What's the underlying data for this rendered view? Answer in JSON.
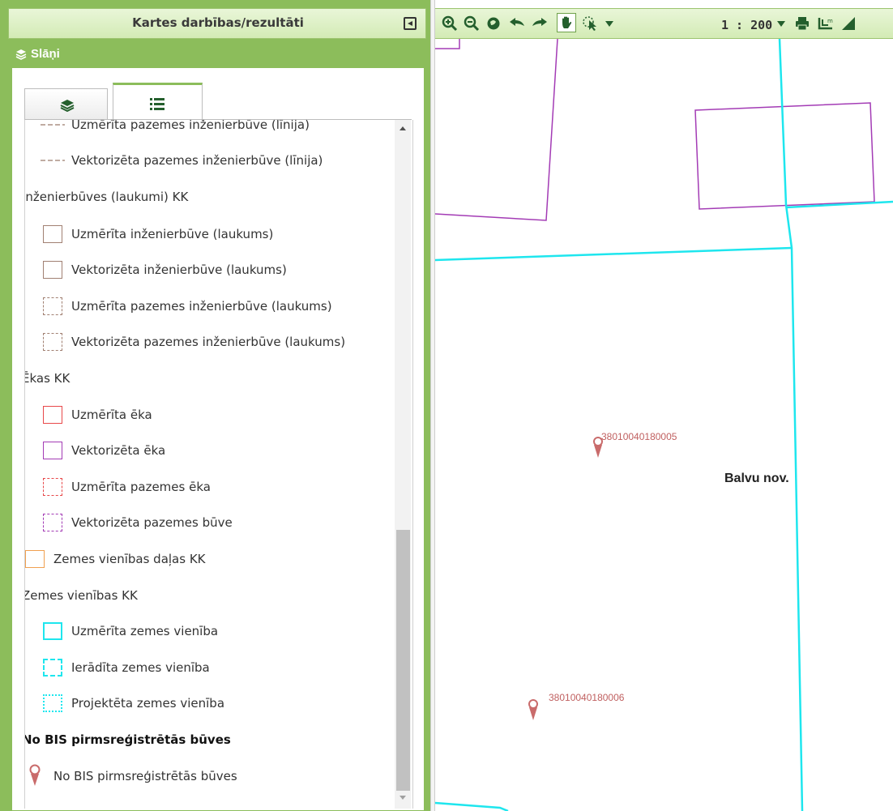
{
  "panel": {
    "title": "Kartes darbības/rezultāti",
    "layers_title": "Slāņi"
  },
  "legend": {
    "row1": "Uzmērīta pazemes inženierbūve (līnija)",
    "row2": "Vektorizēta pazemes inženierbūve (līnija)",
    "group1": "Inženierbūves (laukumi) KK",
    "row3": "Uzmērīta inženierbūve (laukums)",
    "row4": "Vektorizēta inženierbūve (laukums)",
    "row5": "Uzmērīta pazemes inženierbūve (laukums)",
    "row6": "Vektorizēta pazemes inženierbūve (laukums)",
    "group2": "Ēkas KK",
    "row7": "Uzmērīta ēka",
    "row8": "Vektorizēta ēka",
    "row9": "Uzmērīta pazemes ēka",
    "row10": "Vektorizēta pazemes būve",
    "row11": "Zemes vienības daļas KK",
    "group3": "Zemes vienības KK",
    "row12": "Uzmērīta zemes vienība",
    "row13": "Ierādīta zemes vienība",
    "row14": "Projektēta zemes vienība",
    "group4": "No BIS pirmsreģistrētās būves",
    "row15": "No BIS pirmsreģistrētās būves"
  },
  "map": {
    "scale": "1 : 200",
    "region_label": "Balvu nov.",
    "pin1": "38010040180005",
    "pin2": "38010040180006"
  },
  "colors": {
    "panel_green": "#8cbd5b",
    "parcel_cyan": "#1ee6ee",
    "building_purple": "#a33bb5",
    "pin_red": "#c96b6b"
  }
}
